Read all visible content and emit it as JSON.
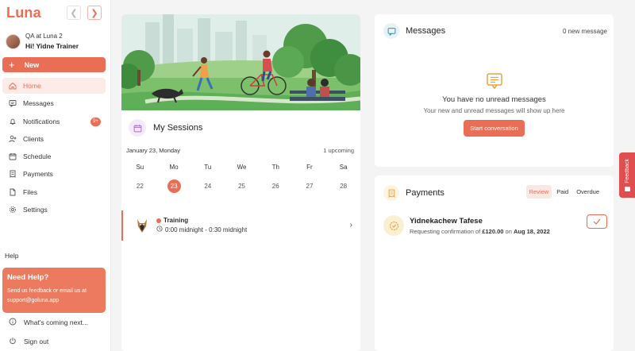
{
  "app": {
    "logo": "Luna"
  },
  "nav": {
    "back_icon": "chevron-left-icon",
    "forward_icon": "chevron-right-icon"
  },
  "profile": {
    "subtitle": "QA at Luna 2",
    "greeting": "Hi! Yidne Trainer"
  },
  "sidebar": {
    "new_label": "New",
    "items": [
      {
        "label": "Home",
        "icon": "home-icon",
        "active": true
      },
      {
        "label": "Messages",
        "icon": "message-icon"
      },
      {
        "label": "Notifications",
        "icon": "bell-icon",
        "badge": "9+"
      },
      {
        "label": "Clients",
        "icon": "user-plus-icon"
      },
      {
        "label": "Schedule",
        "icon": "calendar-icon"
      },
      {
        "label": "Payments",
        "icon": "receipt-icon"
      },
      {
        "label": "Files",
        "icon": "file-icon"
      },
      {
        "label": "Settings",
        "icon": "gear-icon"
      }
    ],
    "help_label": "Help",
    "help_card": {
      "title": "Need Help?",
      "body_line1": "Send us feedback or email us at",
      "body_line2": "support@goluna.app"
    },
    "whats_next": "What's coming next...",
    "sign_out": "Sign out"
  },
  "sessions": {
    "title": "My Sessions",
    "date": "January 23, Monday",
    "upcoming": "1 upcoming",
    "weekdays": [
      "Su",
      "Mo",
      "Tu",
      "We",
      "Th",
      "Fr",
      "Sa"
    ],
    "days": [
      "22",
      "23",
      "24",
      "25",
      "26",
      "27",
      "28"
    ],
    "today": "23",
    "item": {
      "name": "Training",
      "time": "0:00 midnight - 0:30 midnight"
    }
  },
  "messages": {
    "title": "Messages",
    "count": "0 new message",
    "empty_title": "You have no unread messages",
    "empty_sub": "Your new and unread messages will show up here",
    "start_button": "Start conversation"
  },
  "payments": {
    "title": "Payments",
    "tabs": [
      "Review",
      "Paid",
      "Overdue"
    ],
    "active_tab": "Review",
    "item": {
      "name": "Yidnekachew Tafese",
      "desc_prefix": "Requesting confirmation of",
      "amount": "£120.00",
      "desc_mid": "on",
      "date": "Aug 18, 2022"
    }
  },
  "feedback": {
    "label": "Feedback"
  },
  "colors": {
    "accent": "#ea6e55",
    "feedback": "#e04f4f",
    "background": "#f4f4f5"
  }
}
